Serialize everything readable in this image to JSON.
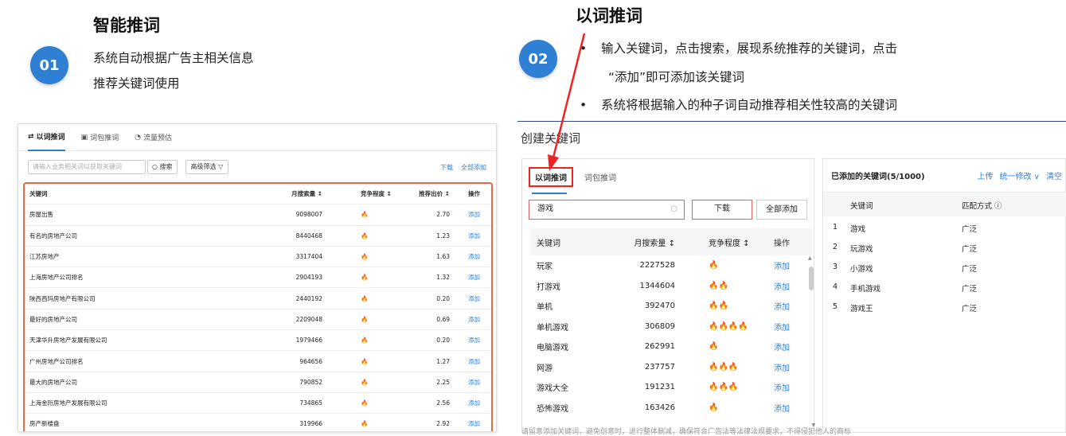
{
  "section1": {
    "number": "01",
    "title": "智能推词",
    "desc_lines": [
      "系统自动根据广告主相关信息",
      "推荐关键词使用"
    ]
  },
  "section2": {
    "number": "02",
    "title": "以词推词",
    "bullets": [
      "输入关键词，点击搜索，展现系统推荐的关键词，点击",
      "“添加”即可添加该关键词",
      "系统将根据输入的种子词自动推荐相关性较高的关键词"
    ]
  },
  "left_panel": {
    "tabs": [
      "以词推词",
      "词包推词",
      "流量预估"
    ],
    "search_placeholder": "请输入业务相关词以获取关键词",
    "search_button": "搜索",
    "filter_button": "高级筛选",
    "download": "下载",
    "add_all": "全部添加",
    "columns": [
      "关键词",
      "月搜索量 ↕",
      "竞争程度 ↕",
      "推荐出价 ↕",
      "操作"
    ],
    "rows": [
      {
        "kw": "房屋出售",
        "vol": "9098007",
        "comp": "🔥",
        "bid": "2.70",
        "op": "添加"
      },
      {
        "kw": "有名的房地产公司",
        "vol": "8440468",
        "comp": "🔥",
        "bid": "1.23",
        "op": "添加"
      },
      {
        "kw": "江苏房地产",
        "vol": "3317404",
        "comp": "🔥",
        "bid": "1.63",
        "op": "添加"
      },
      {
        "kw": "上海房地产公司排名",
        "vol": "2904193",
        "comp": "🔥",
        "bid": "1.32",
        "op": "添加"
      },
      {
        "kw": "陕西西玛房地产有限公司",
        "vol": "2440192",
        "comp": "🔥",
        "bid": "0.20",
        "op": "添加"
      },
      {
        "kw": "最好的房地产公司",
        "vol": "2209048",
        "comp": "🔥",
        "bid": "0.69",
        "op": "添加"
      },
      {
        "kw": "天津华升房地产发展有限公司",
        "vol": "1979466",
        "comp": "🔥",
        "bid": "0.20",
        "op": "添加"
      },
      {
        "kw": "广州房地产公司排名",
        "vol": "964656",
        "comp": "🔥",
        "bid": "1.27",
        "op": "添加"
      },
      {
        "kw": "最大的房地产公司",
        "vol": "790852",
        "comp": "🔥",
        "bid": "2.25",
        "op": "添加"
      },
      {
        "kw": "上海金珩房地产发展有限公司",
        "vol": "734865",
        "comp": "🔥",
        "bid": "2.56",
        "op": "添加"
      },
      {
        "kw": "房产新楼盘",
        "vol": "319966",
        "comp": "🔥",
        "bid": "2.92",
        "op": "添加"
      }
    ]
  },
  "right_panel": {
    "title": "创建关键词",
    "tabs": [
      "以词推词",
      "词包推词"
    ],
    "search_value": "游戏",
    "download": "下载",
    "add_all": "全部添加",
    "columns": [
      "关键词",
      "月搜索量 ↕",
      "竞争程度 ↕",
      "操作"
    ],
    "rows": [
      {
        "kw": "玩家",
        "vol": "2227528",
        "comp": "🔥",
        "op": "添加"
      },
      {
        "kw": "打游戏",
        "vol": "1344604",
        "comp": "🔥🔥",
        "op": "添加"
      },
      {
        "kw": "单机",
        "vol": "392470",
        "comp": "🔥🔥",
        "op": "添加"
      },
      {
        "kw": "单机游戏",
        "vol": "306809",
        "comp": "🔥🔥🔥🔥",
        "op": "添加"
      },
      {
        "kw": "电脑游戏",
        "vol": "262991",
        "comp": "🔥",
        "op": "添加"
      },
      {
        "kw": "网游",
        "vol": "237757",
        "comp": "🔥🔥🔥",
        "op": "添加"
      },
      {
        "kw": "游戏大全",
        "vol": "191231",
        "comp": "🔥🔥🔥",
        "op": "添加"
      },
      {
        "kw": "恐怖游戏",
        "vol": "163426",
        "comp": "🔥",
        "op": "添加"
      }
    ],
    "added_header": "已添加的关键词(5/1000)",
    "upload": "上传",
    "edit_all": "统一修改 ∨",
    "clear": "清空",
    "added_columns": [
      "关键词",
      "匹配方式 ⓘ"
    ],
    "added": [
      {
        "idx": "1",
        "kw": "游戏",
        "match": "广泛"
      },
      {
        "idx": "2",
        "kw": "玩游戏",
        "match": "广泛"
      },
      {
        "idx": "3",
        "kw": "小游戏",
        "match": "广泛"
      },
      {
        "idx": "4",
        "kw": "手机游戏",
        "match": "广泛"
      },
      {
        "idx": "5",
        "kw": "游戏王",
        "match": "广泛"
      }
    ],
    "footer": "请留意添加关键词，避免创意时，进行整体删减，确保符合广告法等法律法规要求，不得侵犯他人的商标"
  },
  "colors": {
    "accent": "#2f7fd4",
    "highlight": "#e22222",
    "flame": "#f39221"
  }
}
